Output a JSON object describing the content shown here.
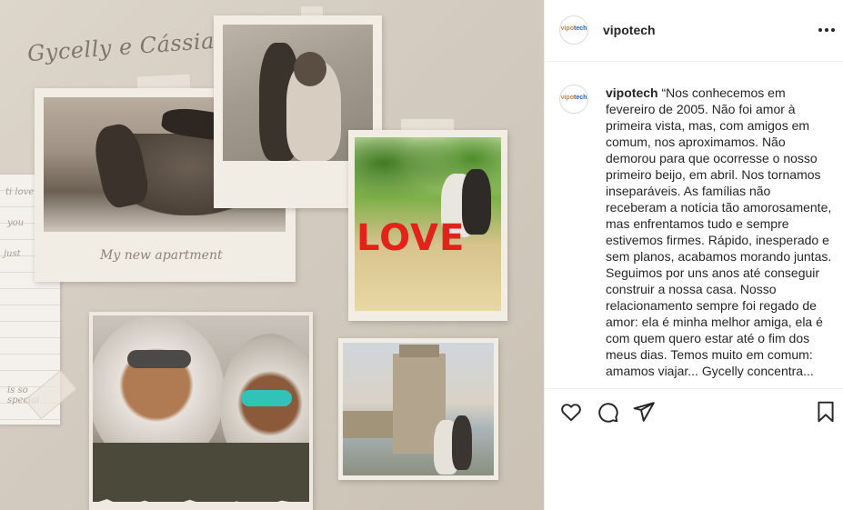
{
  "post_image": {
    "title_script": "Gycelly e Cássia",
    "caption_polaroid": "My new apartment",
    "love_word": "LOVE",
    "notebook_lines": [
      "ti love",
      "you",
      "just",
      "is so special"
    ]
  },
  "header": {
    "avatar_label_a": "vipo",
    "avatar_label_b": "tech",
    "username": "vipotech"
  },
  "caption": {
    "username": "vipotech",
    "text": "“Nos conhecemos em fevereiro de 2005. Não foi amor à primeira vista, mas, com amigos em comum, nos aproximamos. Não demorou para que ocorresse o nosso primeiro beijo, em abril. Nos tornamos inseparáveis. As famílias não receberam a notícia tão amorosamente, mas enfrentamos tudo e sempre estivemos firmes. Rápido, inesperado e sem planos, acabamos morando juntas. Seguimos por uns anos até conseguir construir a nossa casa. Nosso relacionamento sempre foi regado de amor: ela é minha melhor amiga, ela é com quem quero estar até o fim dos meus dias. Temos muito em comum: amamos viajar... Gycelly concentra..."
  },
  "actions": {
    "icons": [
      "heart-icon",
      "comment-icon",
      "share-icon",
      "bookmark-icon"
    ]
  },
  "colors": {
    "text": "#262626",
    "border": "#efefef",
    "love_red": "#e2231a",
    "backdrop": "#d6cec2"
  }
}
